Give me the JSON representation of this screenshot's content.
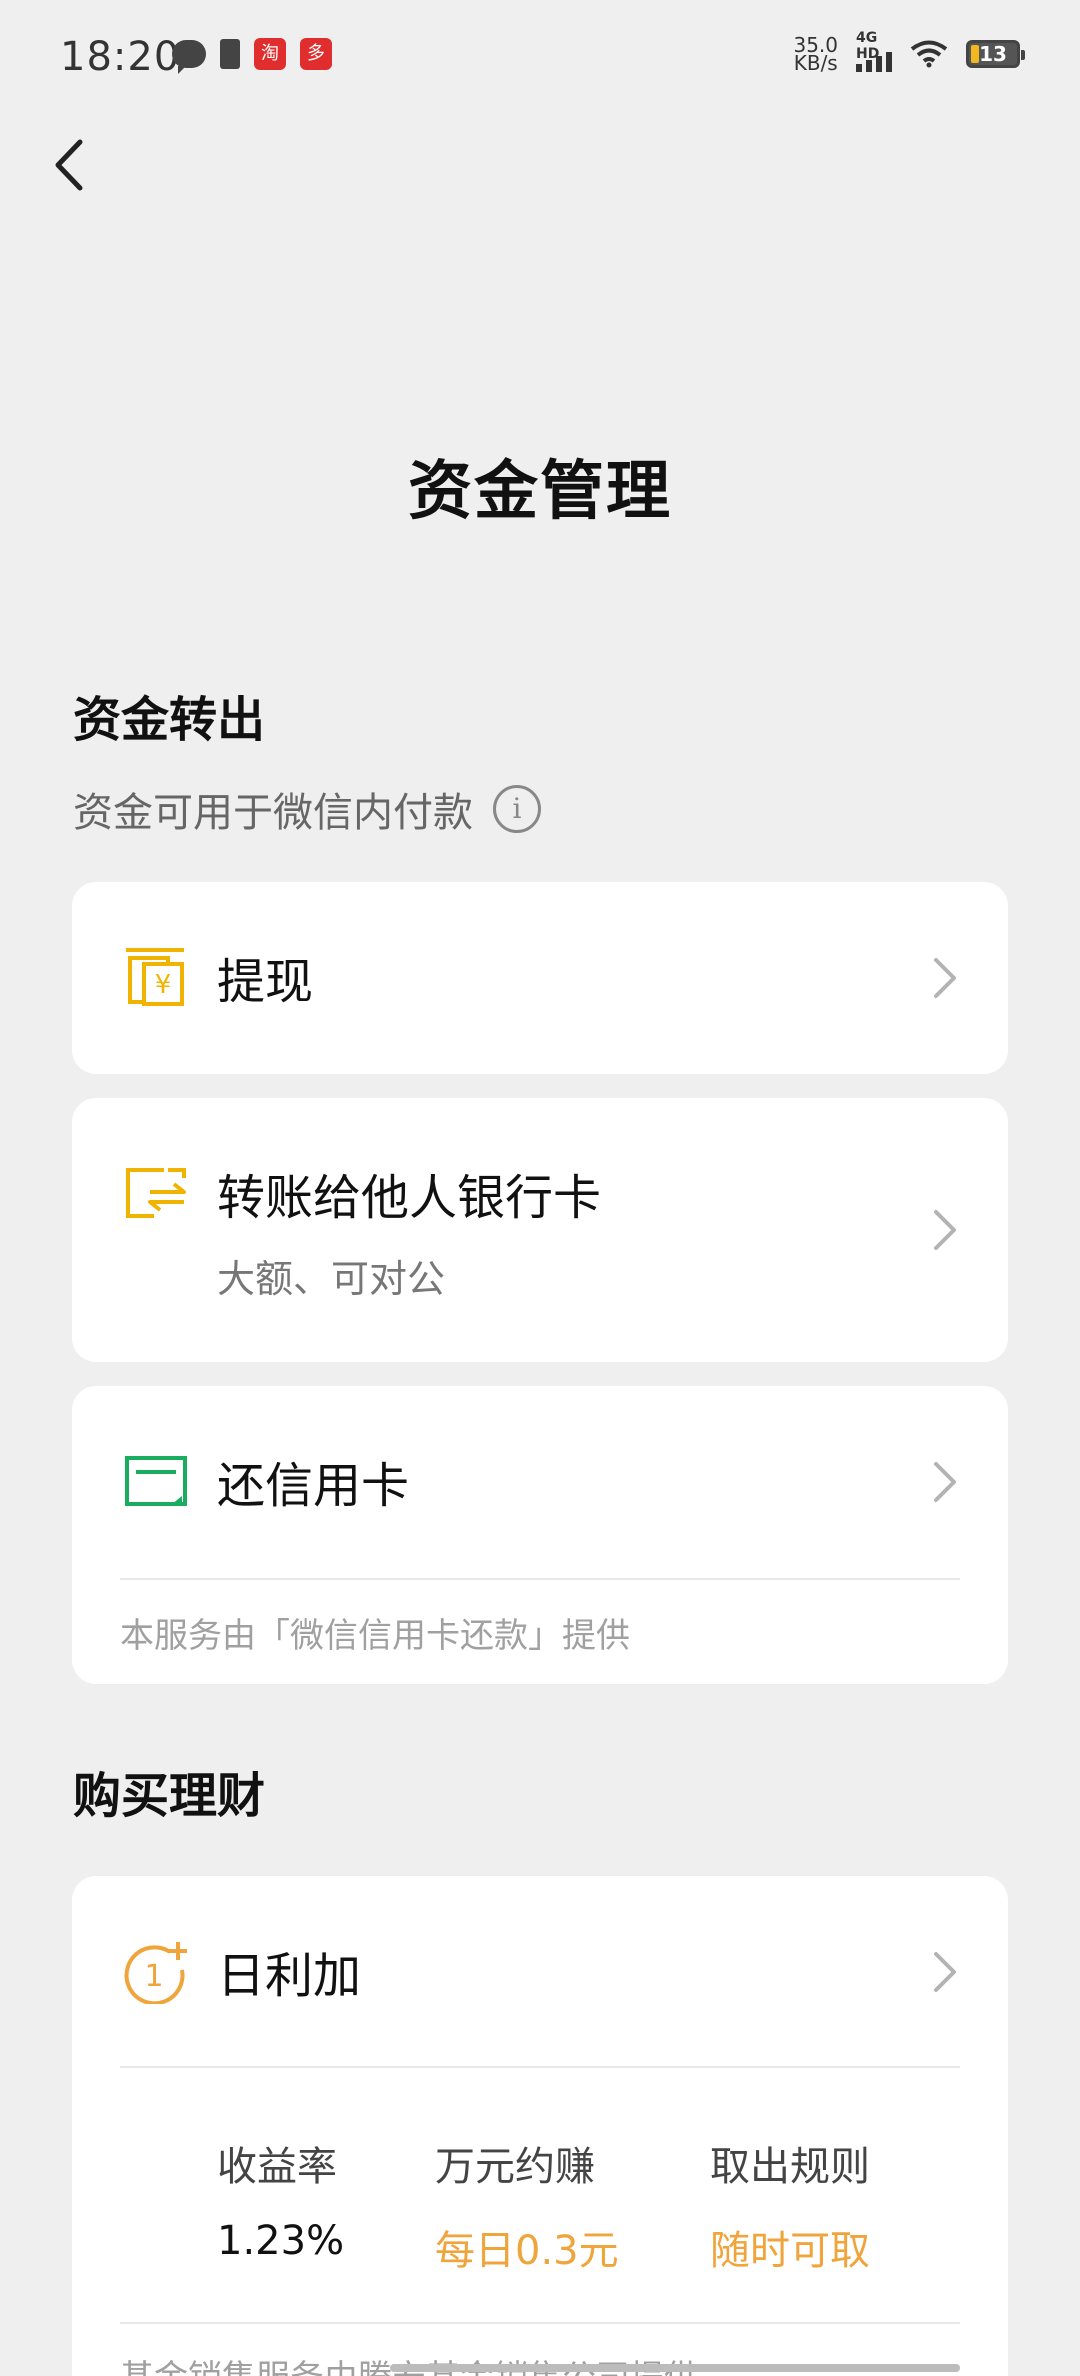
{
  "status_bar": {
    "time": "18:20",
    "app_badge_1": "淘",
    "app_badge_2": "多",
    "net_speed_value": "35.0",
    "net_speed_unit": "KB/s",
    "signal_label": "4G HD",
    "battery_level": "13"
  },
  "page": {
    "title": "资金管理"
  },
  "transfer_section": {
    "title": "资金转出",
    "subtitle": "资金可用于微信内付款",
    "info_glyph": "i",
    "items": [
      {
        "label": "提现",
        "icon": "withdraw-yuan-icon",
        "color": "#f0b400"
      },
      {
        "label": "转账给他人银行卡",
        "sublabel": "大额、可对公",
        "icon": "bank-transfer-icon",
        "color": "#f0b400"
      },
      {
        "label": "还信用卡",
        "icon": "credit-card-icon",
        "color": "#1aad5f",
        "note": "本服务由「微信信用卡还款」提供"
      }
    ]
  },
  "invest_section": {
    "title": "购买理财",
    "product": {
      "label": "日利加",
      "icon": "daily-plus-icon",
      "color": "#f0a53c",
      "stats": [
        {
          "label": "收益率",
          "value": "1.23%"
        },
        {
          "label": "万元约赚",
          "value": "每日0.3元"
        },
        {
          "label": "取出规则",
          "value": "随时可取"
        }
      ],
      "value_highlight_color": "#f0a53c",
      "bottom_note": "基金销售服务由腾安基金销售公司提供"
    }
  }
}
